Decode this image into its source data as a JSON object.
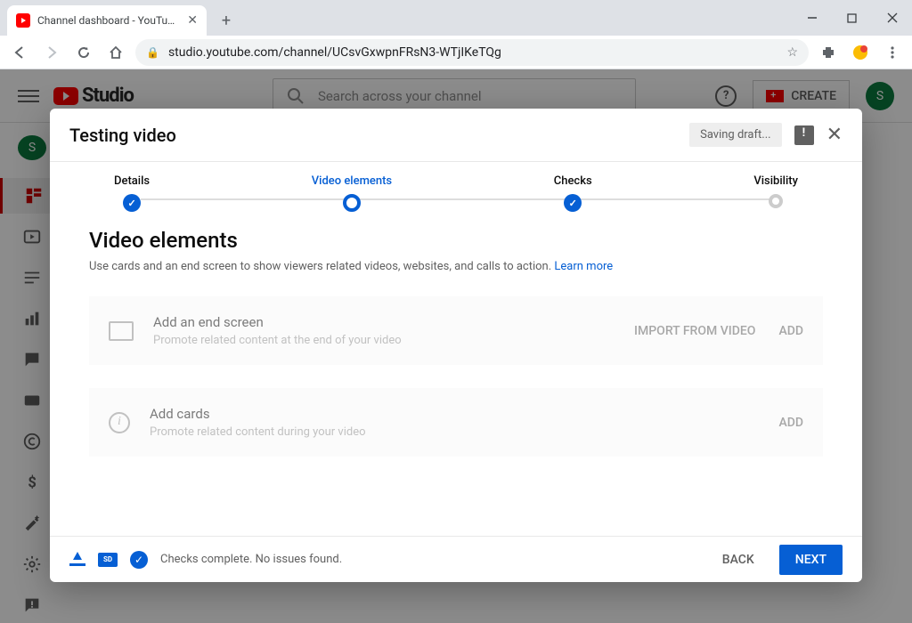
{
  "browser": {
    "tab_title": "Channel dashboard - YouTube St",
    "url": "studio.youtube.com/channel/UCsvGxwpnFRsN3-WTjIKeTQg"
  },
  "studio": {
    "logo_text": "Studio",
    "search_placeholder": "Search across your channel",
    "create_label": "CREATE",
    "avatar_letter": "S"
  },
  "modal": {
    "title": "Testing video",
    "saving_text": "Saving draft...",
    "steps": {
      "details": "Details",
      "video_elements": "Video elements",
      "checks": "Checks",
      "visibility": "Visibility"
    },
    "body": {
      "heading": "Video elements",
      "subtext": "Use cards and an end screen to show viewers related videos, websites, and calls to action. ",
      "learn_more": "Learn more"
    },
    "end_screen": {
      "title": "Add an end screen",
      "sub": "Promote related content at the end of your video",
      "import": "IMPORT FROM VIDEO",
      "add": "ADD"
    },
    "cards": {
      "title": "Add cards",
      "sub": "Promote related content during your video",
      "add": "ADD"
    },
    "footer": {
      "status": "Checks complete. No issues found.",
      "back": "BACK",
      "next": "NEXT"
    }
  }
}
